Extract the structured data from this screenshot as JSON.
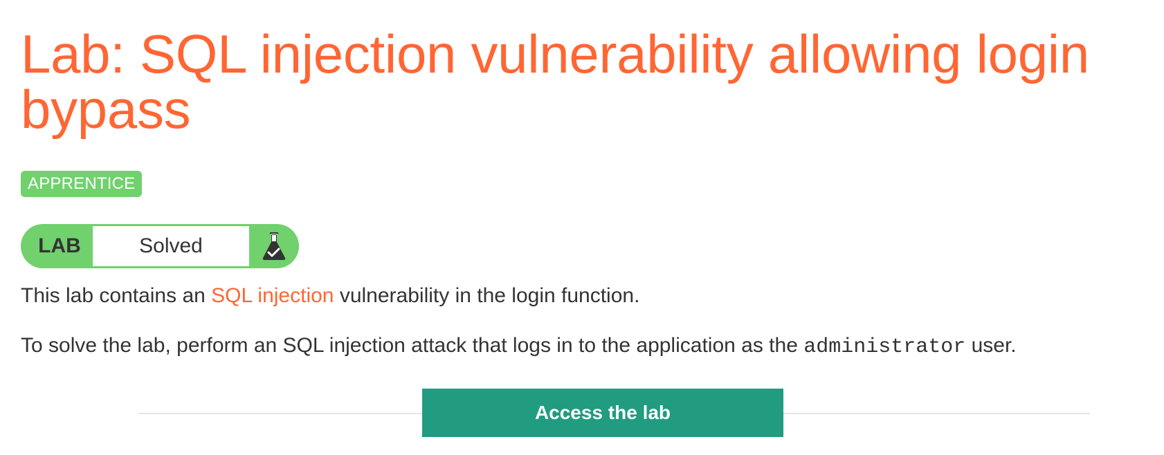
{
  "title": "Lab: SQL injection vulnerability allowing login bypass",
  "level": "APPRENTICE",
  "status": {
    "lab_label": "LAB",
    "text": "Solved",
    "icon": "flask-check-icon"
  },
  "description": {
    "p1_before": "This lab contains an ",
    "p1_link": "SQL injection",
    "p1_after": " vulnerability in the login function.",
    "p2_before": "To solve the lab, perform an SQL injection attack that logs in to the application as the ",
    "p2_code": "administrator",
    "p2_after": " user."
  },
  "access_button": "Access the lab",
  "colors": {
    "accent": "#ff6633",
    "level_green": "#70d16d",
    "button_teal": "#219c81",
    "text": "#333332"
  }
}
